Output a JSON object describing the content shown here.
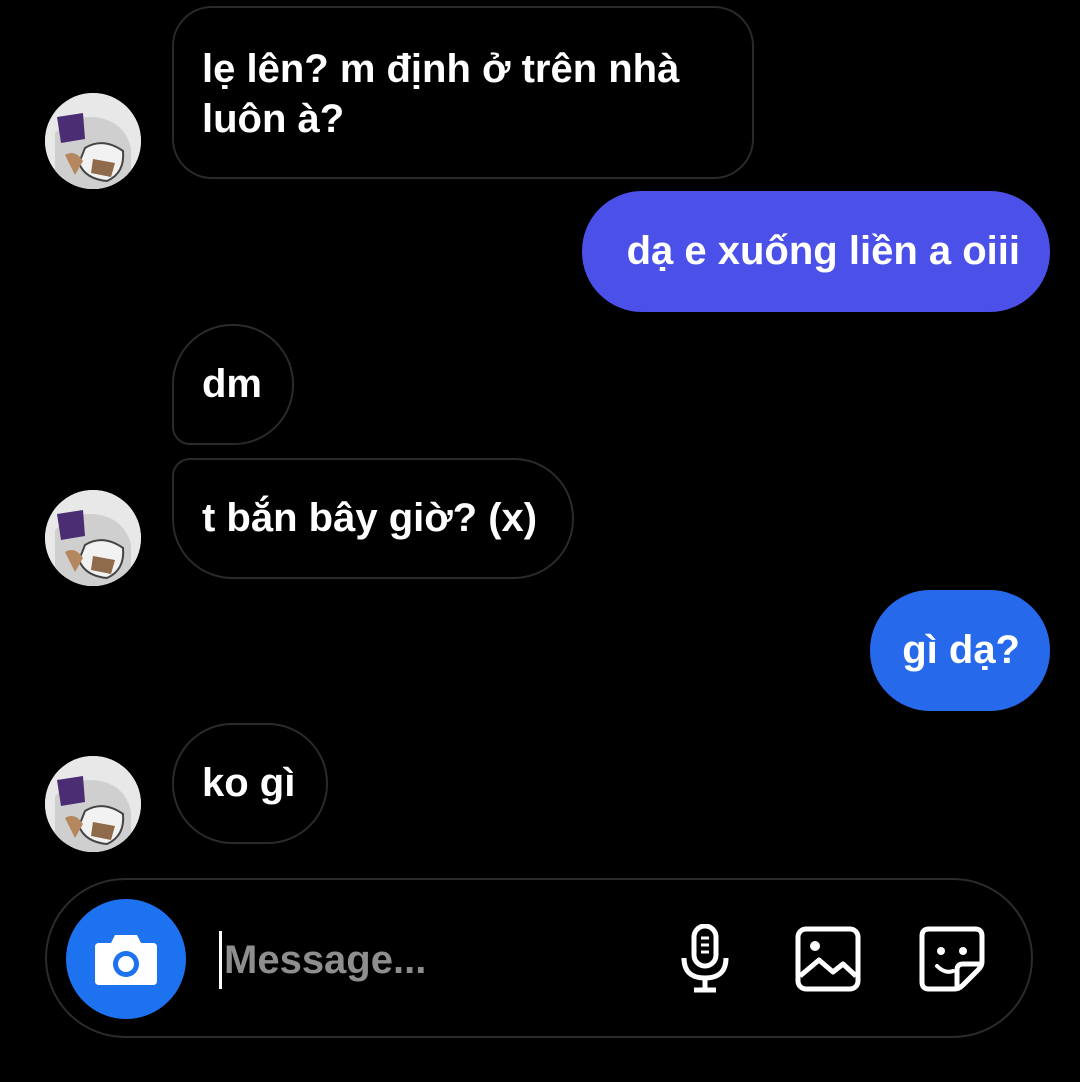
{
  "conversation": {
    "messages": [
      {
        "side": "incoming",
        "text_lines": [
          "lẹ lên? m định ở trên nhà",
          "luôn à?"
        ],
        "show_avatar": true
      },
      {
        "side": "outgoing",
        "text": "dạ e xuống liền a oiii",
        "color": "#4b50e8"
      },
      {
        "side": "incoming",
        "text": "dm",
        "show_avatar": false
      },
      {
        "side": "incoming",
        "text": "t bắn bây giờ? (x)",
        "show_avatar": true
      },
      {
        "side": "outgoing",
        "text": "gì dạ?",
        "color": "#2669ea"
      },
      {
        "side": "incoming",
        "text": "ko gì",
        "show_avatar": true
      }
    ]
  },
  "composer": {
    "placeholder": "Message...",
    "icons": [
      "camera-icon",
      "microphone-icon",
      "gallery-icon",
      "sticker-icon"
    ],
    "camera_button_color": "#1d72f0"
  }
}
